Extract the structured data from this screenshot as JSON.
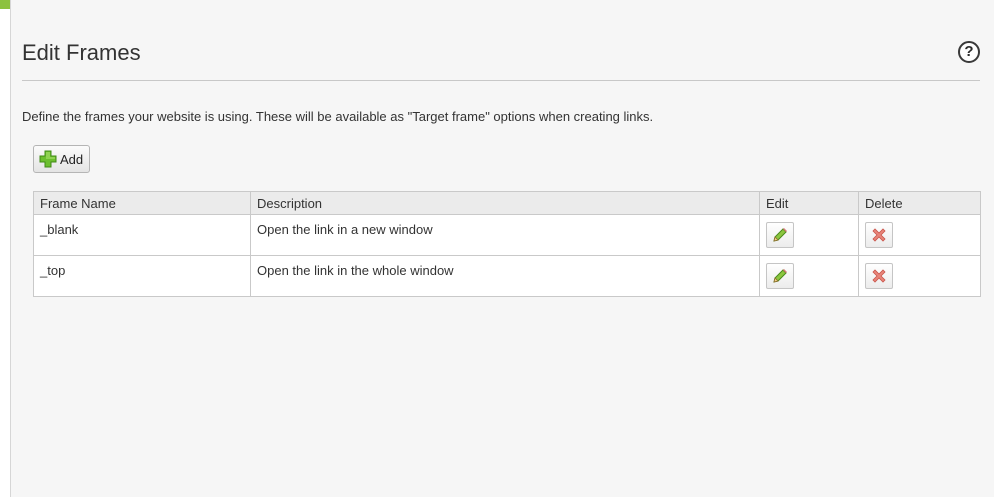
{
  "header": {
    "title": "Edit Frames",
    "help_label": "?"
  },
  "intro_text": "Define the frames your website is using. These will be available as \"Target frame\" options when creating links.",
  "toolbar": {
    "add_label": "Add"
  },
  "table": {
    "columns": [
      "Frame Name",
      "Description",
      "Edit",
      "Delete"
    ],
    "rows": [
      {
        "name": "_blank",
        "description": "Open the link in a new window"
      },
      {
        "name": "_top",
        "description": "Open the link in the whole window"
      }
    ]
  },
  "icons": {
    "add": "plus-icon",
    "edit": "pencil-icon",
    "delete": "x-icon",
    "help": "help-icon"
  },
  "colors": {
    "add_green": "#6cbf2f",
    "delete_red": "#e36a5c",
    "panel_bg": "#f6f6f6"
  }
}
